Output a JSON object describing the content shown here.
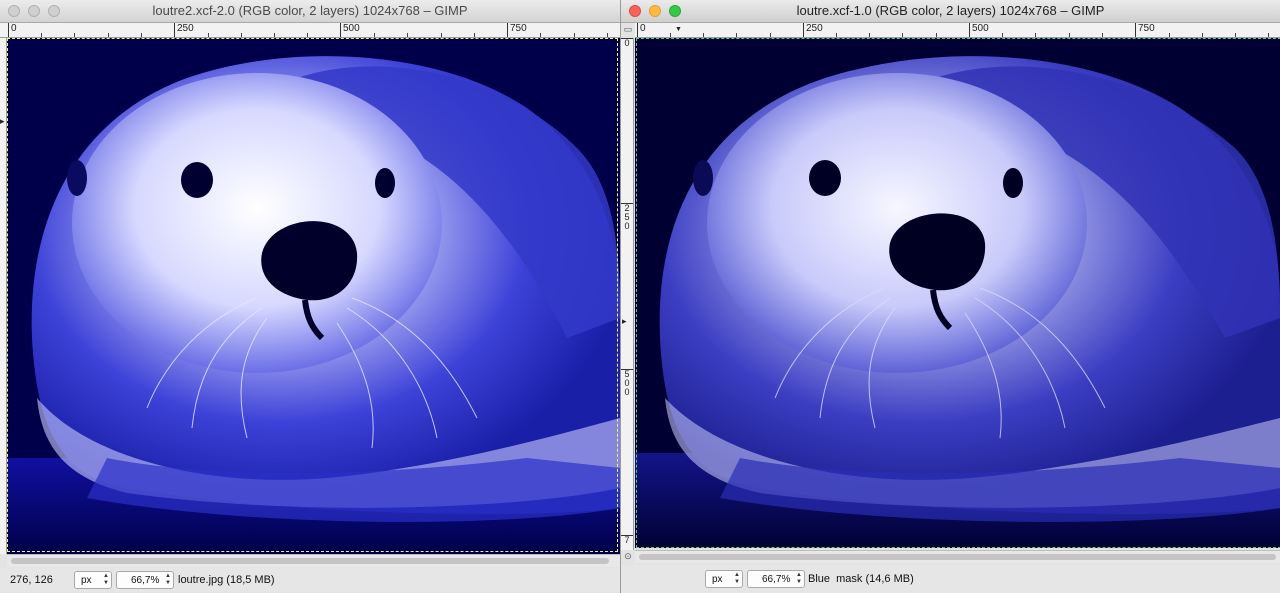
{
  "left_window": {
    "title": "loutre2.xcf-2.0 (RGB color, 2 layers) 1024x768 – GIMP",
    "ruler_h": [
      "0",
      "250",
      "500",
      "750"
    ],
    "status": {
      "coords": "276, 126",
      "unit": "px",
      "zoom": "66,7%",
      "info": "loutre.jpg (18,5 MB)"
    },
    "colors": {
      "image_tint": "#2a2fd0",
      "background": "#00004a"
    }
  },
  "right_window": {
    "title": "loutre.xcf-1.0 (RGB color, 2 layers) 1024x768 – GIMP",
    "ruler_h": [
      "0",
      "250",
      "500",
      "750"
    ],
    "ruler_v": [
      {
        "label": "0",
        "chars": [
          "0"
        ]
      },
      {
        "label": "250",
        "chars": [
          "2",
          "5",
          "0"
        ]
      },
      {
        "label": "500",
        "chars": [
          "5",
          "0",
          "0"
        ]
      },
      {
        "label": "7",
        "chars": [
          "7"
        ]
      }
    ],
    "status": {
      "unit": "px",
      "zoom": "66,7%",
      "info": "Blue  mask (14,6 MB)"
    },
    "colors": {
      "image_tint": "#3a3cc8",
      "background": "#000033"
    }
  }
}
